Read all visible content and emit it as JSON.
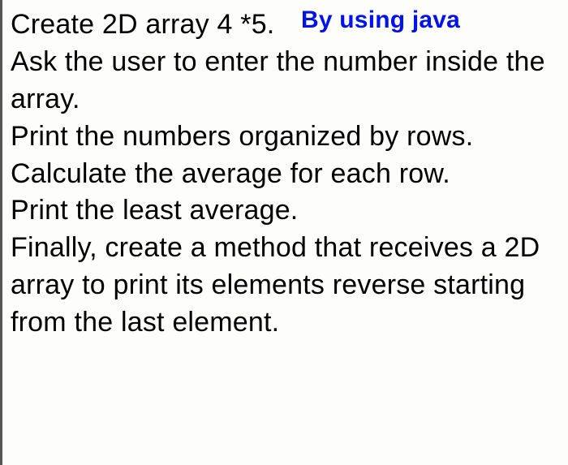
{
  "content": {
    "line1_main": "Create 2D array 4 *5.",
    "line1_annotation": "By using java",
    "line2": "Ask the user to enter the number inside the array.",
    "line3": "Print the numbers organized by rows.",
    "line4": "Calculate the average for each row.",
    "line5": "Print the least average.",
    "line6": "Finally, create a method that receives a 2D array to print its elements reverse starting from the last element."
  }
}
